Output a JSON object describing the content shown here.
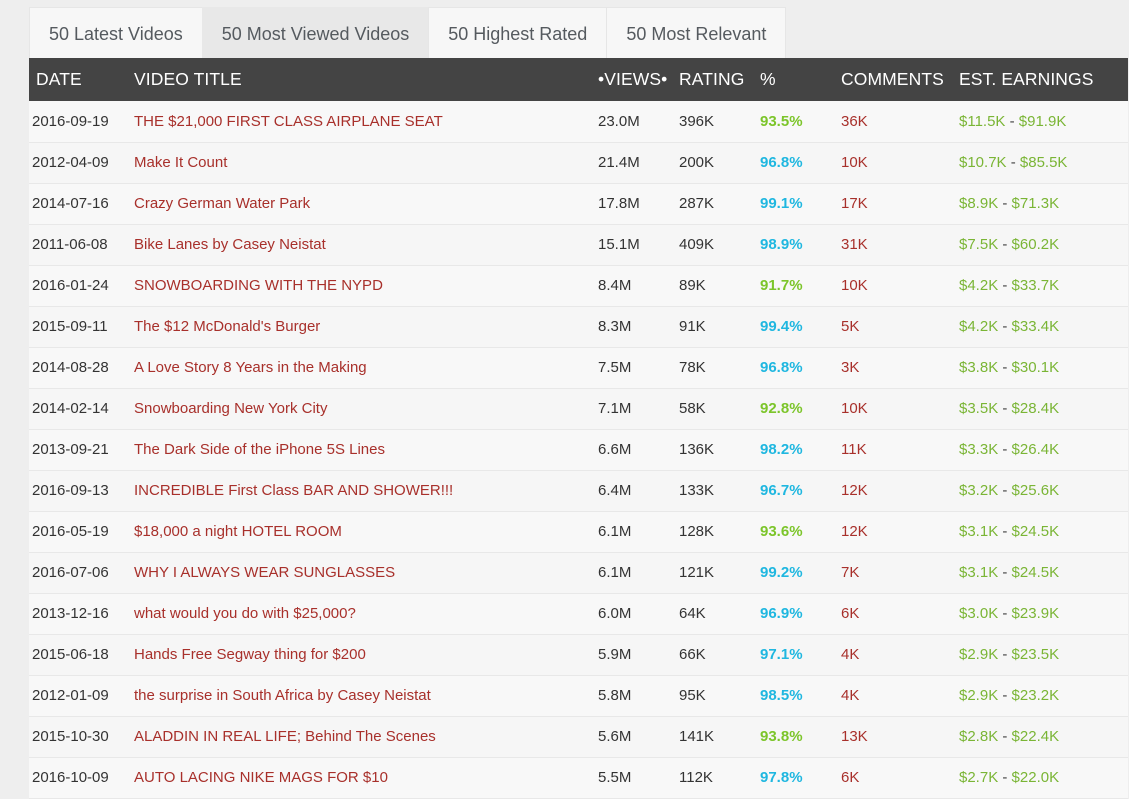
{
  "tabs": [
    {
      "label": "50 Latest Videos",
      "active": false
    },
    {
      "label": "50 Most Viewed Videos",
      "active": true
    },
    {
      "label": "50 Highest Rated",
      "active": false
    },
    {
      "label": "50 Most Relevant",
      "active": false
    }
  ],
  "table": {
    "headers": {
      "date": "DATE",
      "title": "VIDEO TITLE",
      "views": "•VIEWS•",
      "rating": "RATING",
      "pct": "%",
      "comments": "COMMENTS",
      "earnings": "EST. EARNINGS"
    },
    "colors": {
      "title": "#a8302b",
      "pct_high": "#1fb7e0",
      "pct_mid": "#7cc52a",
      "earnings": "#7ab535",
      "header_bg": "#444444"
    },
    "rows": [
      {
        "date": "2016-09-19",
        "title": "THE $21,000 FIRST CLASS AIRPLANE SEAT",
        "views": "23.0M",
        "rating": "396K",
        "pct": "93.5%",
        "pct_level": "mid",
        "comments": "36K",
        "earn_low": "$11.5K",
        "earn_high": "$91.9K"
      },
      {
        "date": "2012-04-09",
        "title": "Make It Count",
        "views": "21.4M",
        "rating": "200K",
        "pct": "96.8%",
        "pct_level": "high",
        "comments": "10K",
        "earn_low": "$10.7K",
        "earn_high": "$85.5K"
      },
      {
        "date": "2014-07-16",
        "title": "Crazy German Water Park",
        "views": "17.8M",
        "rating": "287K",
        "pct": "99.1%",
        "pct_level": "high",
        "comments": "17K",
        "earn_low": "$8.9K",
        "earn_high": "$71.3K"
      },
      {
        "date": "2011-06-08",
        "title": "Bike Lanes by Casey Neistat",
        "views": "15.1M",
        "rating": "409K",
        "pct": "98.9%",
        "pct_level": "high",
        "comments": "31K",
        "earn_low": "$7.5K",
        "earn_high": "$60.2K"
      },
      {
        "date": "2016-01-24",
        "title": "SNOWBOARDING WITH THE NYPD",
        "views": "8.4M",
        "rating": "89K",
        "pct": "91.7%",
        "pct_level": "mid",
        "comments": "10K",
        "earn_low": "$4.2K",
        "earn_high": "$33.7K"
      },
      {
        "date": "2015-09-11",
        "title": "The $12 McDonald's Burger",
        "views": "8.3M",
        "rating": "91K",
        "pct": "99.4%",
        "pct_level": "high",
        "comments": "5K",
        "earn_low": "$4.2K",
        "earn_high": "$33.4K"
      },
      {
        "date": "2014-08-28",
        "title": "A Love Story 8 Years in the Making",
        "views": "7.5M",
        "rating": "78K",
        "pct": "96.8%",
        "pct_level": "high",
        "comments": "3K",
        "earn_low": "$3.8K",
        "earn_high": "$30.1K"
      },
      {
        "date": "2014-02-14",
        "title": "Snowboarding New York City",
        "views": "7.1M",
        "rating": "58K",
        "pct": "92.8%",
        "pct_level": "mid",
        "comments": "10K",
        "earn_low": "$3.5K",
        "earn_high": "$28.4K"
      },
      {
        "date": "2013-09-21",
        "title": "The Dark Side of the iPhone 5S Lines",
        "views": "6.6M",
        "rating": "136K",
        "pct": "98.2%",
        "pct_level": "high",
        "comments": "11K",
        "earn_low": "$3.3K",
        "earn_high": "$26.4K"
      },
      {
        "date": "2016-09-13",
        "title": "INCREDIBLE First Class BAR AND SHOWER!!!",
        "views": "6.4M",
        "rating": "133K",
        "pct": "96.7%",
        "pct_level": "high",
        "comments": "12K",
        "earn_low": "$3.2K",
        "earn_high": "$25.6K"
      },
      {
        "date": "2016-05-19",
        "title": "$18,000 a night HOTEL ROOM",
        "views": "6.1M",
        "rating": "128K",
        "pct": "93.6%",
        "pct_level": "mid",
        "comments": "12K",
        "earn_low": "$3.1K",
        "earn_high": "$24.5K"
      },
      {
        "date": "2016-07-06",
        "title": "WHY I ALWAYS WEAR SUNGLASSES",
        "views": "6.1M",
        "rating": "121K",
        "pct": "99.2%",
        "pct_level": "high",
        "comments": "7K",
        "earn_low": "$3.1K",
        "earn_high": "$24.5K"
      },
      {
        "date": "2013-12-16",
        "title": "what would you do with $25,000?",
        "views": "6.0M",
        "rating": "64K",
        "pct": "96.9%",
        "pct_level": "high",
        "comments": "6K",
        "earn_low": "$3.0K",
        "earn_high": "$23.9K"
      },
      {
        "date": "2015-06-18",
        "title": "Hands Free Segway thing for $200",
        "views": "5.9M",
        "rating": "66K",
        "pct": "97.1%",
        "pct_level": "high",
        "comments": "4K",
        "earn_low": "$2.9K",
        "earn_high": "$23.5K"
      },
      {
        "date": "2012-01-09",
        "title": "the surprise in South Africa by Casey Neistat",
        "views": "5.8M",
        "rating": "95K",
        "pct": "98.5%",
        "pct_level": "high",
        "comments": "4K",
        "earn_low": "$2.9K",
        "earn_high": "$23.2K"
      },
      {
        "date": "2015-10-30",
        "title": "ALADDIN IN REAL LIFE; Behind The Scenes",
        "views": "5.6M",
        "rating": "141K",
        "pct": "93.8%",
        "pct_level": "mid",
        "comments": "13K",
        "earn_low": "$2.8K",
        "earn_high": "$22.4K"
      },
      {
        "date": "2016-10-09",
        "title": "AUTO LACING NIKE MAGS FOR $10",
        "views": "5.5M",
        "rating": "112K",
        "pct": "97.8%",
        "pct_level": "high",
        "comments": "6K",
        "earn_low": "$2.7K",
        "earn_high": "$22.0K"
      }
    ],
    "earnings_separator": " - "
  }
}
